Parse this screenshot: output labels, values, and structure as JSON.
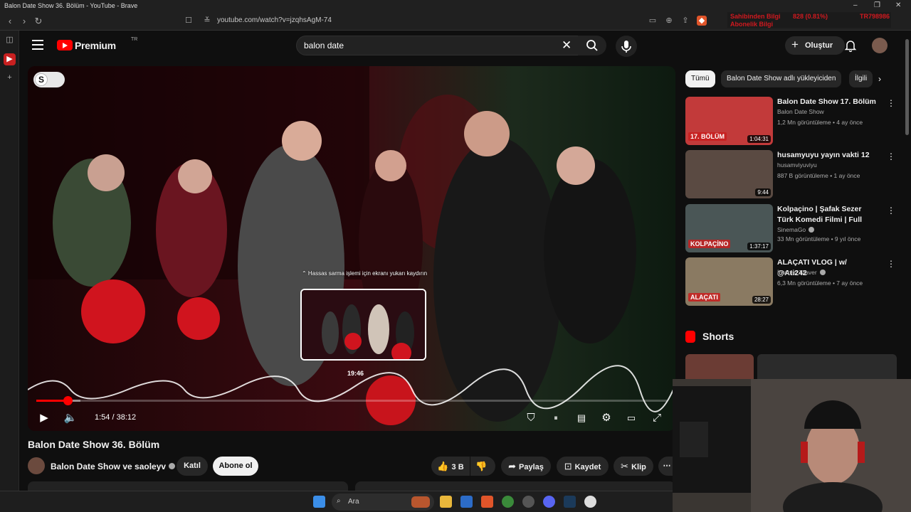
{
  "browser": {
    "window_title": "Balon Date Show 36. Bölüm - YouTube - Brave",
    "url": "youtube.com/watch?v=jzqhsAgM-74",
    "overlay_text": [
      "Sahibinden Bilgi",
      "828 (0.81%)",
      "TR798986",
      "Abonelik Bilgi"
    ]
  },
  "yt": {
    "logo_text": "Premium",
    "logo_country": "TR",
    "search_value": "balon date",
    "create_label": "Oluştur"
  },
  "player": {
    "hint": "⌃ Hassas sarma işlemi için ekranı yukarı kaydırın",
    "preview_time": "19:46",
    "time_current": "1:54",
    "time_total": "38:12",
    "time_display": "1:54 / 38:12",
    "progress_played": 0.05,
    "progress_buffered": 0.07,
    "preview_position": 0.52,
    "overlay_badge": "S"
  },
  "video": {
    "title": "Balon Date Show 36. Bölüm",
    "channel": "Balon Date Show ve saoleyv",
    "join_label": "Katıl",
    "subscribe_label": "Abone ol",
    "likes": "3 B",
    "share_label": "Paylaş",
    "save_label": "Kaydet",
    "clip_label": "Klip"
  },
  "chips": [
    "Tümü",
    "Balon Date Show adlı yükleyiciden",
    "İlgili"
  ],
  "recommendations": [
    {
      "title": "Balon Date Show 17. Bölüm",
      "channel": "Balon Date Show",
      "meta": "1,2 Mn görüntüleme • 4 ay önce",
      "duration": "1:04:31",
      "badge": "17. BÖLÜM",
      "verified": false,
      "thumb_color": "#c23a3a"
    },
    {
      "title": "husamyuyu yayın vakti 12",
      "channel": "husamviyuviyu",
      "meta": "887 B görüntüleme • 1 ay önce",
      "duration": "9:44",
      "badge": "",
      "verified": false,
      "thumb_color": "#5a4a42"
    },
    {
      "title": "Kolpaçino | Şafak Sezer Türk Komedi Filmi | Full Film İzle ...",
      "channel": "SinemaGo",
      "meta": "33 Mn görüntüleme • 9 yıl önce",
      "duration": "1:37:17",
      "badge": "KOLPAÇİNO",
      "verified": true,
      "thumb_color": "#4a5656"
    },
    {
      "title": "ALAÇATI VLOG | w/ @Ati242",
      "channel": "İbrahim Tilaver",
      "meta": "6,3 Mn görüntüleme • 7 ay önce",
      "duration": "28:27",
      "badge": "ALAÇATI",
      "verified": true,
      "thumb_color": "#8a7a62"
    }
  ],
  "shorts_label": "Shorts",
  "taskbar": {
    "search_placeholder": "Ara"
  },
  "colors": {
    "accent": "#ff0000",
    "bg": "#0f0f0f",
    "chip": "#272727"
  }
}
